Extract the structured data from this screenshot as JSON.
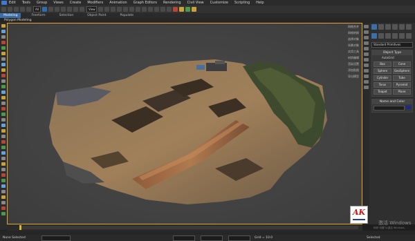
{
  "menu": [
    "Edit",
    "Tools",
    "Group",
    "Views",
    "Create",
    "Modifiers",
    "Animation",
    "Graph Editors",
    "Rendering",
    "Civil View",
    "Customize",
    "Scripting",
    "Help"
  ],
  "toolbar": {
    "selection_filter": "All",
    "coord_system": "View"
  },
  "ribbon": {
    "tabs": [
      "Modeling",
      "Freeform",
      "Selection",
      "Object Paint",
      "Populate"
    ],
    "active": "Modeling"
  },
  "subribbon": {
    "label": "Polygon Modeling"
  },
  "viewport": {
    "label": "[+] [Perspective ] [Facets+Hi ]"
  },
  "right_labels": [
    "网格合并",
    "网格转换",
    "选择对象",
    "场景对象",
    "实用工具",
    "材质编辑",
    "渲染设置",
    "添加贴图",
    "导出模型"
  ],
  "command_panel": {
    "category": "Standard Primitives",
    "object_type": {
      "title": "Object Type",
      "autogrid": "AutoGrid",
      "buttons": [
        "Box",
        "Cone",
        "Sphere",
        "GeoSphere",
        "Cylinder",
        "Tube",
        "Torus",
        "Pyramid",
        "Teapot",
        "Plane"
      ]
    },
    "name_color": {
      "title": "Name and Color"
    },
    "swatch_color": "#1b2a8a"
  },
  "status": {
    "left": "None Selected",
    "right": "Selected",
    "grid": "Grid = 10.0"
  },
  "logo": {
    "text": "AK"
  },
  "watermark": {
    "line1": "激活 Windows",
    "line2": "转到\"设置\"以激活 Windows。"
  }
}
